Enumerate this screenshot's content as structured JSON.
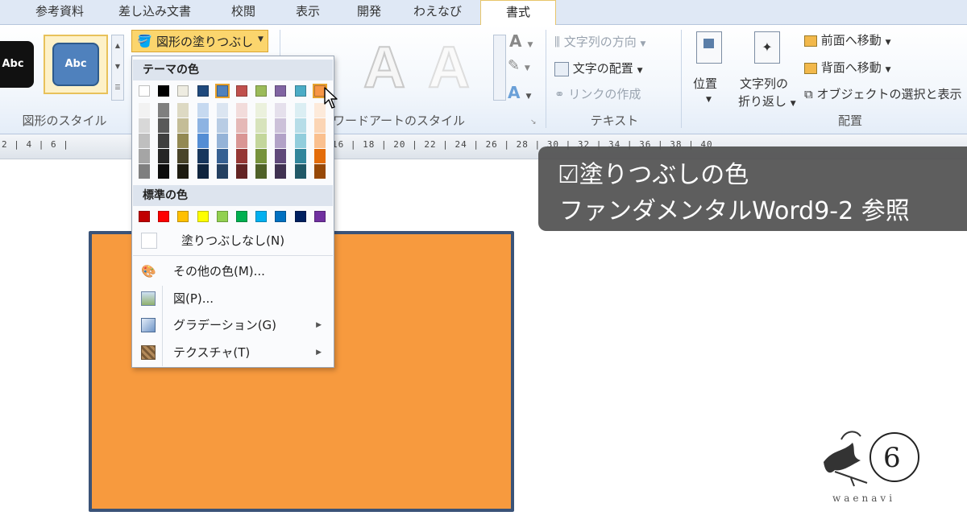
{
  "tabs": [
    {
      "label": "参考資料"
    },
    {
      "label": "差し込み文書"
    },
    {
      "label": "校閲"
    },
    {
      "label": "表示"
    },
    {
      "label": "開発"
    },
    {
      "label": "わえなび"
    },
    {
      "label": "書式"
    }
  ],
  "ribbon": {
    "shape_styles": {
      "thumb1_text": "Abc",
      "thumb2_text": "Abc",
      "fill_button": "図形の塗りつぶし",
      "group_label": "図形のスタイル"
    },
    "wordart": {
      "letter": "A",
      "group_label": "ワードアートのスタイル"
    },
    "text_group": {
      "direction": "文字列の方向",
      "align": "文字の配置",
      "link": "リンクの作成",
      "group_label": "テキスト"
    },
    "arrange_group": {
      "position": "位置",
      "wrap_line1": "文字列の",
      "wrap_line2": "折り返し",
      "front": "前面へ移動",
      "back": "背面へ移動",
      "select_pane": "オブジェクトの選択と表示",
      "group_label": "配置"
    }
  },
  "ruler": {
    "numbers": "2 | 4 | 6 |",
    "numbers_right": "16 | 18 | 20 | 22 | 24 | 26 | 28 | 30 | 32 | 34 | 36 | 38 | 40"
  },
  "dropdown": {
    "theme_heading": "テーマの色",
    "standard_heading": "標準の色",
    "no_fill": "塗りつぶしなし(N)",
    "more_colors": "その他の色(M)...",
    "picture": "図(P)...",
    "gradient": "グラデーション(G)",
    "texture": "テクスチャ(T)",
    "theme_colors": [
      "#ffffff",
      "#000000",
      "#eeece1",
      "#1f497d",
      "#4f81bd",
      "#c0504d",
      "#9bbb59",
      "#8064a2",
      "#4bacc6",
      "#f79646"
    ],
    "theme_shades": [
      [
        "#f2f2f2",
        "#d8d8d8",
        "#bfbfbf",
        "#a5a5a5",
        "#7f7f7f"
      ],
      [
        "#7f7f7f",
        "#595959",
        "#3f3f3f",
        "#262626",
        "#0c0c0c"
      ],
      [
        "#ddd9c3",
        "#c4bd97",
        "#938953",
        "#494429",
        "#1d1b10"
      ],
      [
        "#c6d9f0",
        "#8db3e2",
        "#548dd4",
        "#17365d",
        "#0f243e"
      ],
      [
        "#dbe5f1",
        "#b8cce4",
        "#95b3d7",
        "#366092",
        "#244061"
      ],
      [
        "#f2dcdb",
        "#e5b9b7",
        "#d99694",
        "#953734",
        "#632423"
      ],
      [
        "#ebf1dd",
        "#d7e3bc",
        "#c3d69b",
        "#76923c",
        "#4f6128"
      ],
      [
        "#e5e0ec",
        "#ccc1d9",
        "#b2a2c7",
        "#5f497a",
        "#3f3151"
      ],
      [
        "#dbeef3",
        "#b7dde8",
        "#92cddc",
        "#31859b",
        "#205867"
      ],
      [
        "#fdeada",
        "#fbd5b5",
        "#fac08f",
        "#e36c09",
        "#974806"
      ]
    ],
    "standard_colors": [
      "#c00000",
      "#ff0000",
      "#ffc000",
      "#ffff00",
      "#92d050",
      "#00b050",
      "#00b0f0",
      "#0070c0",
      "#002060",
      "#7030a0"
    ]
  },
  "caption": {
    "line1": "☑塗りつぶしの色",
    "line2": "ファンダメンタルWord9-2 参照"
  },
  "logo": {
    "wordmark": "waenavi"
  }
}
